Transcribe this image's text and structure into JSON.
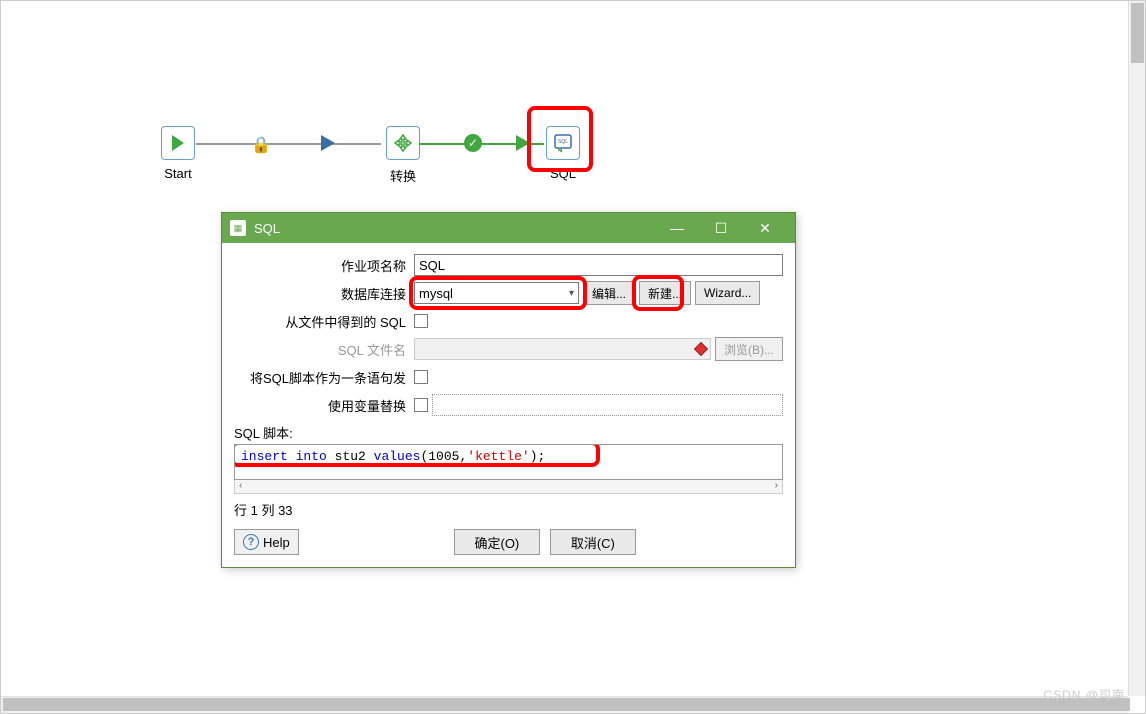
{
  "flow": {
    "start_label": "Start",
    "transform_label": "转换",
    "sql_label": "SQL"
  },
  "dialog": {
    "title": "SQL",
    "labels": {
      "job_name": "作业项名称",
      "db_conn": "数据库连接",
      "sql_from_file": "从文件中得到的 SQL",
      "sql_filename": "SQL 文件名",
      "single_stmt": "将SQL脚本作为一条语句发",
      "var_subst": "使用变量替换",
      "sql_script": "SQL 脚本:"
    },
    "values": {
      "job_name": "SQL",
      "db_conn": "mysql"
    },
    "buttons": {
      "edit": "编辑...",
      "new": "新建...",
      "wizard": "Wizard...",
      "browse": "浏览(B)...",
      "help": "Help",
      "ok": "确定(O)",
      "cancel": "取消(C)"
    },
    "sql": {
      "kw1": "insert into",
      "text1": " stu2 ",
      "kw2": "values",
      "text2": "(1005,",
      "str1": "'kettle'",
      "text3": ");"
    },
    "position": "行 1 列 33"
  },
  "watermark": "CSDN @司南"
}
